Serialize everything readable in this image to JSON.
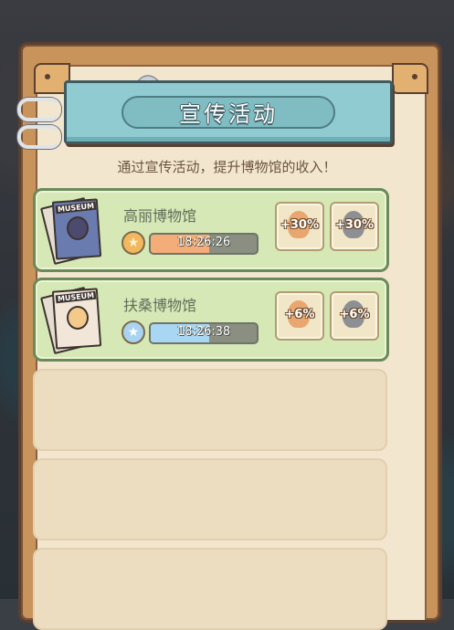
{
  "header": {
    "title": "宣传活动"
  },
  "subtitle": "通过宣传活动，提升博物馆的收入！",
  "campaigns": [
    {
      "name": "高丽博物馆",
      "poster_tag": "MUSEUM",
      "timer": "18:26:26",
      "timer_progress": 0.55,
      "star_color": "gold",
      "bonuses": [
        "+30%",
        "+30%"
      ]
    },
    {
      "name": "扶桑博物馆",
      "poster_tag": "MUSEUM",
      "timer": "18:26:38",
      "timer_progress": 0.55,
      "star_color": "blue",
      "bonuses": [
        "+6%",
        "+6%"
      ]
    }
  ],
  "empty_slots": 3,
  "colors": {
    "panel_wood": "#c9935c",
    "paper": "#f3e6cf",
    "plaque": "#8fcbd0",
    "active_row": "#d6e8b6",
    "empty_row": "#ecdcc0",
    "timer_orange": "#f4ad78",
    "timer_blue": "#a9d7f3"
  }
}
